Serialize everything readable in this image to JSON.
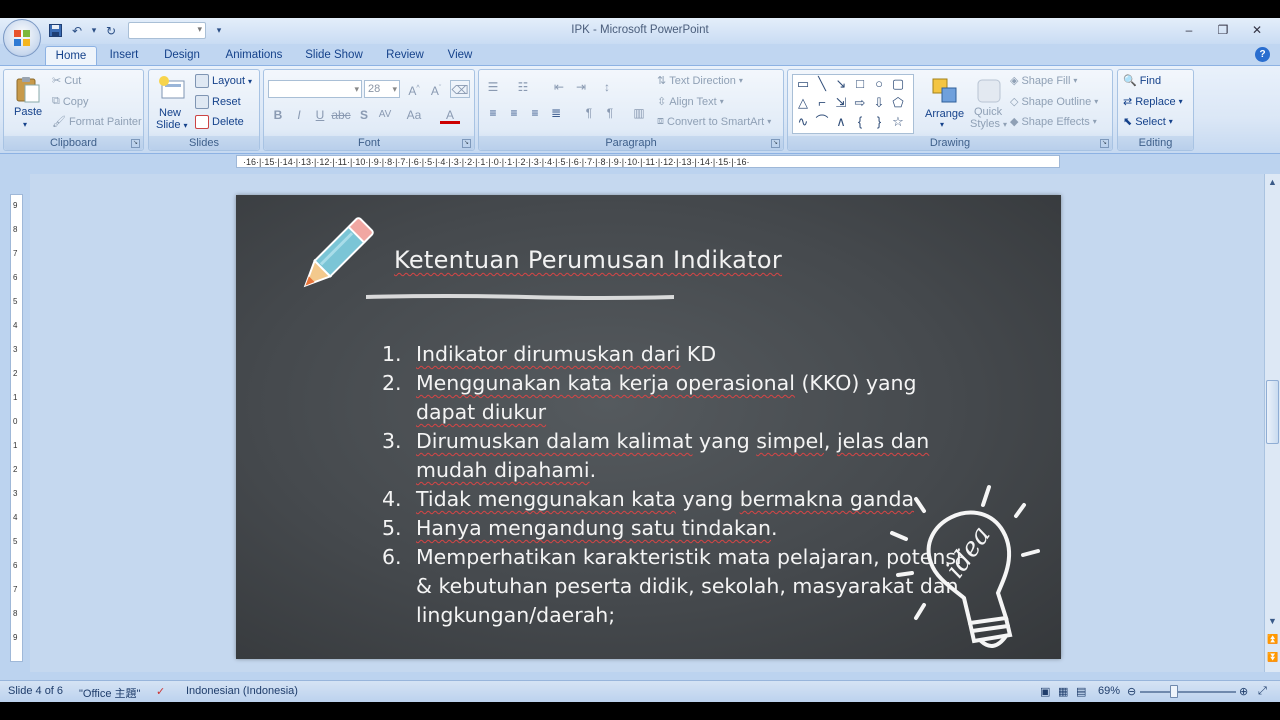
{
  "window": {
    "title": "IPK - Microsoft PowerPoint",
    "controls": [
      "–",
      "❐",
      "✕"
    ]
  },
  "tabs": [
    "Home",
    "Insert",
    "Design",
    "Animations",
    "Slide Show",
    "Review",
    "View"
  ],
  "ribbon": {
    "clipboard": {
      "label": "Clipboard",
      "paste": "Paste",
      "cut": "Cut",
      "copy": "Copy",
      "format_painter": "Format Painter"
    },
    "slides": {
      "label": "Slides",
      "new_slide_1": "New",
      "new_slide_2": "Slide",
      "layout": "Layout",
      "reset": "Reset",
      "delete": "Delete"
    },
    "font": {
      "label": "Font",
      "size": "28"
    },
    "paragraph": {
      "label": "Paragraph",
      "text_direction": "Text Direction",
      "align_text": "Align Text",
      "convert_smartart": "Convert to SmartArt"
    },
    "drawing": {
      "label": "Drawing",
      "arrange": "Arrange",
      "quick_styles_1": "Quick",
      "quick_styles_2": "Styles",
      "shape_fill": "Shape Fill",
      "shape_outline": "Shape Outline",
      "shape_effects": "Shape Effects"
    },
    "editing": {
      "label": "Editing",
      "find": "Find",
      "replace": "Replace",
      "select": "Select"
    }
  },
  "ruler": {
    "ticks": "·16·|·15·|·14·|·13·|·12·|·11·|·10·|·9·|·8·|·7·|·6·|·5·|·4·|·3·|·2·|·1·|·0·|·1·|·2·|·3·|·4·|·5·|·6·|·7·|·8·|·9·|·10·|·11·|·12·|·13·|·14·|·15·|·16·"
  },
  "vruler": [
    "9",
    "8",
    "7",
    "6",
    "5",
    "4",
    "3",
    "2",
    "1",
    "0",
    "1",
    "2",
    "3",
    "4",
    "5",
    "6",
    "7",
    "8",
    "9"
  ],
  "slide": {
    "title": "Ketentuan Perumusan Indikator",
    "items": [
      {
        "num": "1.",
        "parts": [
          [
            "Indikator dirumuskan dari",
            true
          ],
          [
            " KD",
            false
          ]
        ]
      },
      {
        "num": "2.",
        "parts": [
          [
            "Menggunakan kata kerja operasional",
            true
          ],
          [
            " (KKO) yang ",
            false
          ],
          [
            "dapat diukur",
            true
          ]
        ]
      },
      {
        "num": "3.",
        "parts": [
          [
            "Dirumuskan dalam kalimat",
            true
          ],
          [
            " yang ",
            false
          ],
          [
            "simpel",
            true
          ],
          [
            ", ",
            false
          ],
          [
            "jelas dan",
            true
          ],
          [
            " ",
            false
          ],
          [
            "mudah dipahami",
            true
          ],
          [
            ".",
            false
          ]
        ]
      },
      {
        "num": "4.",
        "parts": [
          [
            "Tidak menggunakan kata",
            true
          ],
          [
            " yang ",
            false
          ],
          [
            "bermakna ganda",
            true
          ]
        ]
      },
      {
        "num": "5.",
        "parts": [
          [
            "Hanya mengandung satu tindakan",
            true
          ],
          [
            ".",
            false
          ]
        ]
      },
      {
        "num": "6.",
        "parts": [
          [
            "Memperhatikan karakteristik mata pelajaran, potensi & kebutuhan peserta didik, sekolah, masyarakat dan lingkungan/daerah;",
            false
          ]
        ]
      }
    ],
    "bulb_text": "idea"
  },
  "status": {
    "slide_info": "Slide 4 of 6",
    "theme": "\"Office 主題\"",
    "language": "Indonesian (Indonesia)",
    "zoom": "69%"
  }
}
